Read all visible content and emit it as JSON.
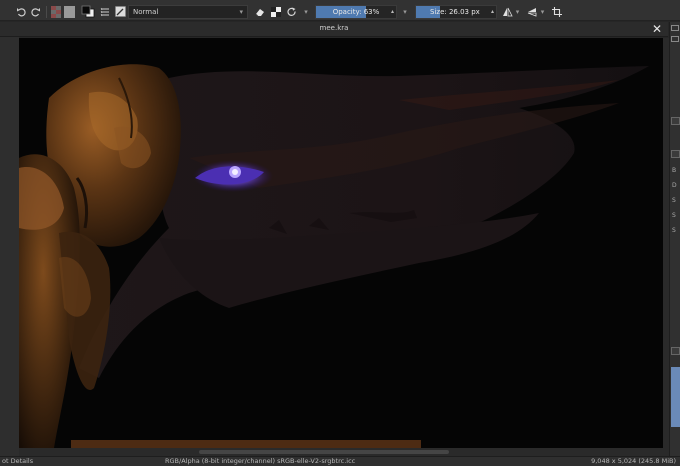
{
  "toolbar": {
    "blend_mode": "Normal",
    "opacity_label": "Opacity: 63%",
    "opacity_value": 0.63,
    "size_label": "Size: 26.03 px",
    "size_fill": 0.3
  },
  "document": {
    "title": "mee.kra",
    "close_glyph": "✕"
  },
  "dock": {
    "labels": [
      "B",
      "D",
      "S",
      "S",
      "S"
    ]
  },
  "status": {
    "left": "ot Details",
    "color_profile": "RGB/Alpha (8-bit integer/channel)  sRGB-elle-V2-srgbtrc.icc",
    "dimensions": "9,048 x 5,024 (245.8 MiB)"
  },
  "colors": {
    "accent_fill": "#4f7ab0",
    "eye_glow": "#7a55ff",
    "skin_warm": "#8a5424",
    "background": "#050505"
  }
}
